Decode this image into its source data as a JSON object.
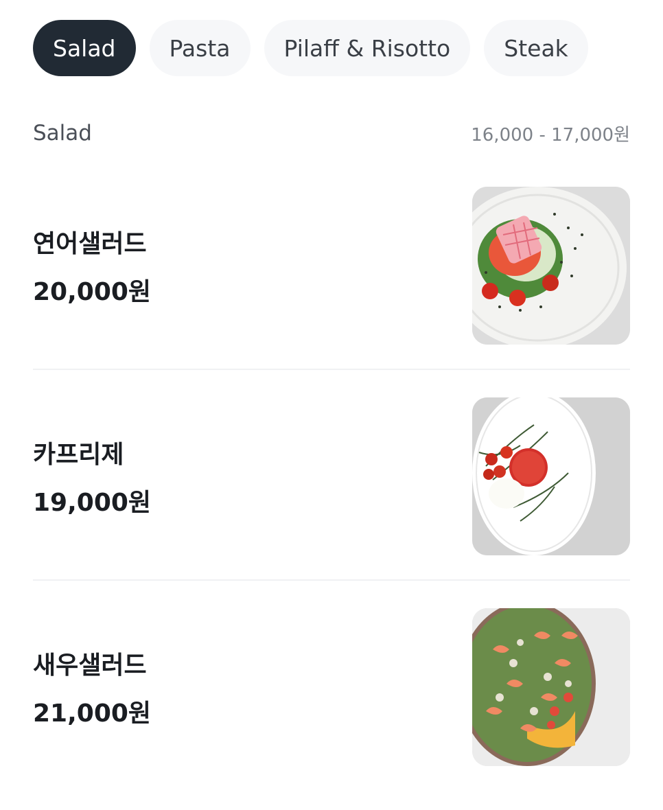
{
  "tabs": [
    {
      "label": "Salad",
      "active": true
    },
    {
      "label": "Pasta",
      "active": false
    },
    {
      "label": "Pilaff & Risotto",
      "active": false
    },
    {
      "label": "Steak",
      "active": false
    }
  ],
  "section": {
    "title": "Salad",
    "price_range": "16,000 - 17,000원"
  },
  "items": [
    {
      "name": "연어샐러드",
      "price": "20,000원",
      "photo": "salmon-salad-photo"
    },
    {
      "name": "카프리제",
      "price": "19,000원",
      "photo": "caprese-photo"
    },
    {
      "name": "새우샐러드",
      "price": "21,000원",
      "photo": "shrimp-salad-photo"
    }
  ],
  "colors": {
    "active_tab_bg": "#212a34",
    "inactive_tab_bg": "#f6f7f9",
    "divider": "#f0f1f3"
  }
}
